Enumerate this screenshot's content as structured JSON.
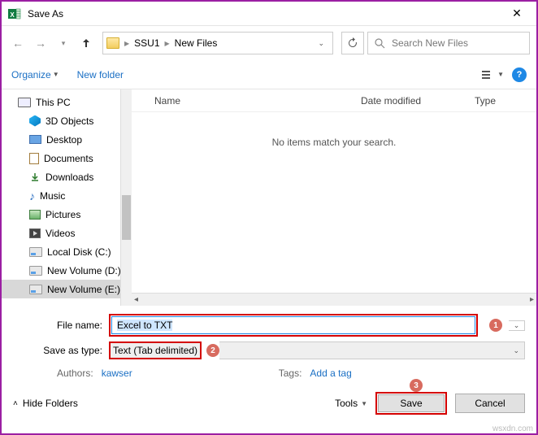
{
  "window": {
    "title": "Save As"
  },
  "nav": {
    "crumb1": "SSU1",
    "crumb2": "New Files",
    "search_placeholder": "Search New Files"
  },
  "commands": {
    "organize": "Organize",
    "newfolder": "New folder"
  },
  "tree": {
    "items": [
      {
        "label": "This PC",
        "icon": "pc"
      },
      {
        "label": "3D Objects",
        "icon": "obj3d"
      },
      {
        "label": "Desktop",
        "icon": "desk"
      },
      {
        "label": "Documents",
        "icon": "doc"
      },
      {
        "label": "Downloads",
        "icon": "dl"
      },
      {
        "label": "Music",
        "icon": "note"
      },
      {
        "label": "Pictures",
        "icon": "pic"
      },
      {
        "label": "Videos",
        "icon": "vid"
      },
      {
        "label": "Local Disk (C:)",
        "icon": "drive"
      },
      {
        "label": "New Volume (D:)",
        "icon": "drive"
      },
      {
        "label": "New Volume (E:)",
        "icon": "drive",
        "selected": true
      }
    ]
  },
  "columns": {
    "name": "Name",
    "date": "Date modified",
    "type": "Type"
  },
  "empty_msg": "No items match your search.",
  "form": {
    "fname_label": "File name:",
    "fname_value": "Excel to TXT",
    "ftype_label": "Save as type:",
    "ftype_value": "Text (Tab delimited)",
    "authors_label": "Authors:",
    "authors_value": "kawser",
    "tags_label": "Tags:",
    "tags_value": "Add a tag"
  },
  "callouts": {
    "c1": "1",
    "c2": "2",
    "c3": "3"
  },
  "footer": {
    "hide": "Hide Folders",
    "tools": "Tools",
    "save": "Save",
    "cancel": "Cancel"
  },
  "watermark": "wsxdn.com"
}
